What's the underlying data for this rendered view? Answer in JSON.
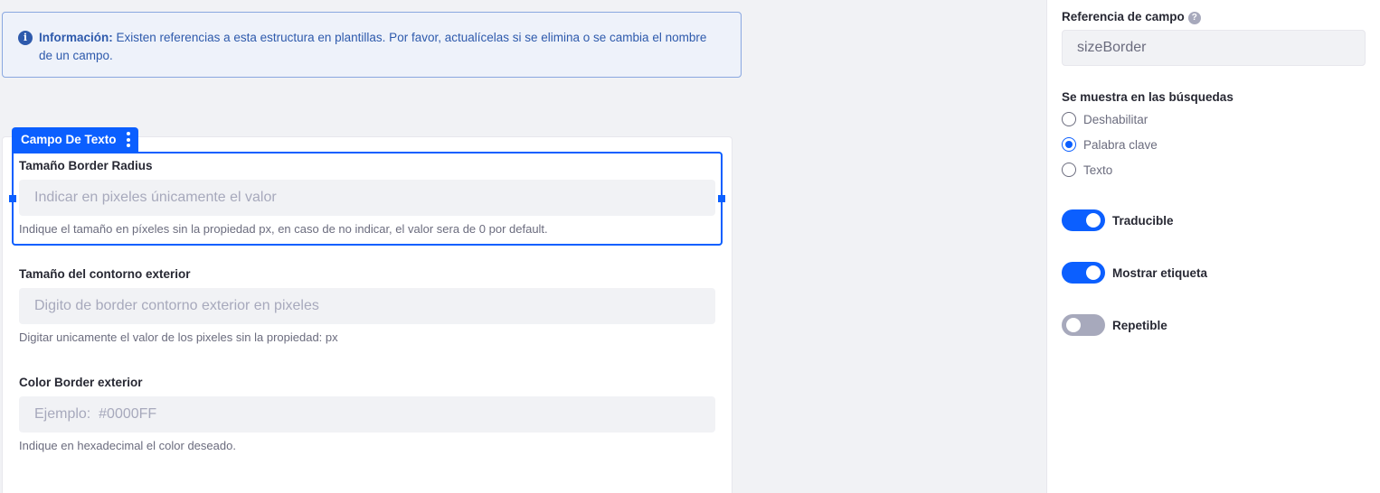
{
  "alert": {
    "lead": "Información:",
    "message": "Existen referencias a esta estructura en plantillas. Por favor, actualícelas si se elimina o se cambia el nombre de un campo."
  },
  "field_tag": {
    "label": "Campo De Texto"
  },
  "fields": [
    {
      "label": "Tamaño Border Radius",
      "placeholder": "Indicar en pixeles únicamente el valor",
      "help": "Indique el tamaño en píxeles sin la propiedad px, en caso de no indicar, el valor sera de 0 por default."
    },
    {
      "label": "Tamaño del contorno exterior",
      "placeholder": "Digito de border contorno exterior en pixeles",
      "help": "Digitar unicamente el valor de los pixeles sin la propiedad: px"
    },
    {
      "label": "Color Border exterior",
      "placeholder": "Ejemplo:  #0000FF",
      "help": "Indique en hexadecimal el color deseado."
    }
  ],
  "sidebar": {
    "field_reference": {
      "label": "Referencia de campo",
      "value": "sizeBorder"
    },
    "search_visibility": {
      "label": "Se muestra en las búsquedas",
      "options": [
        {
          "label": "Deshabilitar",
          "checked": false
        },
        {
          "label": "Palabra clave",
          "checked": true
        },
        {
          "label": "Texto",
          "checked": false
        }
      ]
    },
    "toggles": [
      {
        "label": "Traducible",
        "on": true
      },
      {
        "label": "Mostrar etiqueta",
        "on": true
      },
      {
        "label": "Repetible",
        "on": false
      }
    ]
  },
  "colors": {
    "primary": "#0b5fff",
    "info_text": "#2e5aac",
    "info_bg": "#eef2fa"
  }
}
